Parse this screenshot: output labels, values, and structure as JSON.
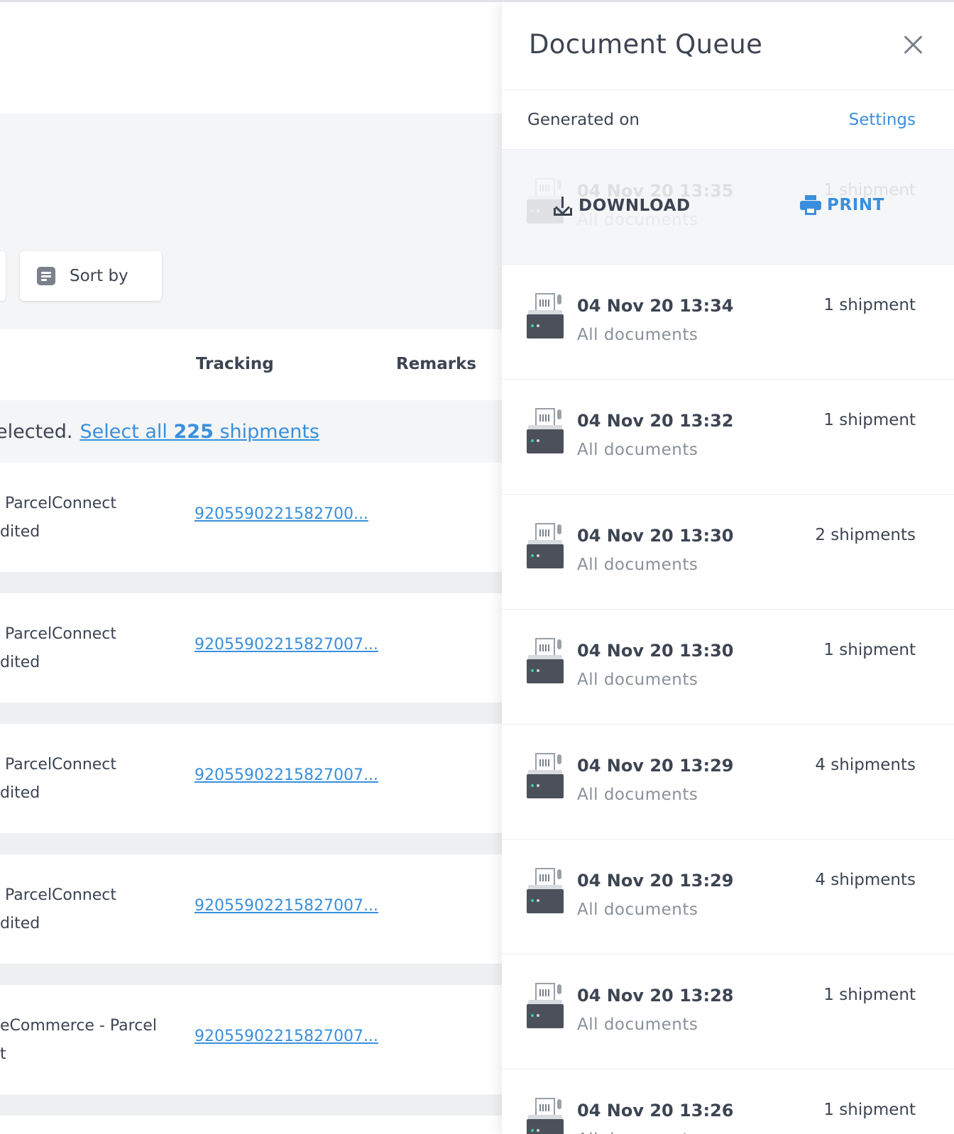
{
  "background": {
    "sort_label": "Sort by",
    "columns": {
      "tracking": "Tracking",
      "remarks": "Remarks"
    },
    "selection": {
      "text": "elected.",
      "link_prefix": "Select all ",
      "count": "225",
      "link_suffix": " shipments"
    },
    "rows": [
      {
        "carrier": " ParcelConnect\ndited",
        "tracking": "9205590221582700..."
      },
      {
        "carrier": " ParcelConnect\ndited",
        "tracking": "92055902215827007..."
      },
      {
        "carrier": " ParcelConnect\ndited",
        "tracking": "92055902215827007..."
      },
      {
        "carrier": " ParcelConnect\ndited",
        "tracking": "92055902215827007..."
      },
      {
        "carrier": "eCommerce - Parcel\nt",
        "tracking": "92055902215827007..."
      }
    ]
  },
  "drawer": {
    "title": "Document Queue",
    "subheader_label": "Generated on",
    "settings_label": "Settings",
    "hovered_item": {
      "date": "04 Nov 20 13:35",
      "docs": "All documents",
      "count": "1 shipment",
      "download_label": "DOWNLOAD",
      "print_label": "PRINT"
    },
    "items": [
      {
        "date": "04 Nov 20 13:34",
        "docs": "All documents",
        "count": "1 shipment"
      },
      {
        "date": "04 Nov 20 13:32",
        "docs": "All documents",
        "count": "1 shipment"
      },
      {
        "date": "04 Nov 20 13:30",
        "docs": "All documents",
        "count": "2 shipments"
      },
      {
        "date": "04 Nov 20 13:30",
        "docs": "All documents",
        "count": "1 shipment"
      },
      {
        "date": "04 Nov 20 13:29",
        "docs": "All documents",
        "count": "4 shipments"
      },
      {
        "date": "04 Nov 20 13:29",
        "docs": "All documents",
        "count": "4 shipments"
      },
      {
        "date": "04 Nov 20 13:28",
        "docs": "All documents",
        "count": "1 shipment"
      },
      {
        "date": "04 Nov 20 13:26",
        "docs": "All documents",
        "count": "1 shipment"
      }
    ],
    "colors": {
      "accent": "#3a8fdc",
      "text": "#3d4452",
      "muted": "#8a909a"
    }
  }
}
